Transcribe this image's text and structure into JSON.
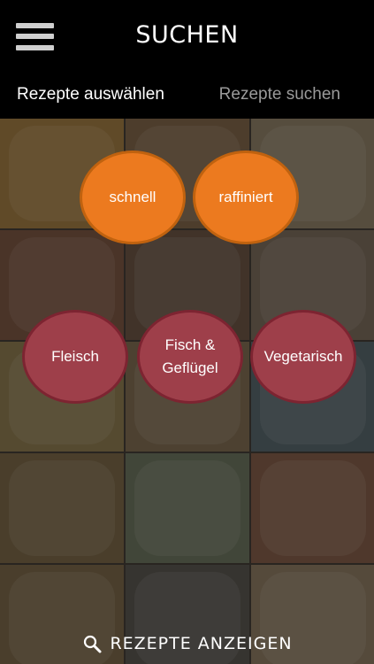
{
  "header": {
    "title": "SUCHEN"
  },
  "tabs": [
    {
      "label": "Rezepte auswählen"
    },
    {
      "label": "Rezepte suchen"
    }
  ],
  "filters": {
    "speed": [
      {
        "label": "schnell"
      },
      {
        "label": "raffiniert"
      }
    ],
    "categories": [
      {
        "label": "Fleisch"
      },
      {
        "label": "Fisch & Geflügel"
      },
      {
        "label": "Vegetarisch"
      }
    ]
  },
  "footer": {
    "label": "REZEPTE ANZEIGEN",
    "icon": "search-icon"
  },
  "colors": {
    "speed_bubble": "#ec7a1f",
    "category_bubble": "#9e3f4a",
    "header": "#000000"
  }
}
